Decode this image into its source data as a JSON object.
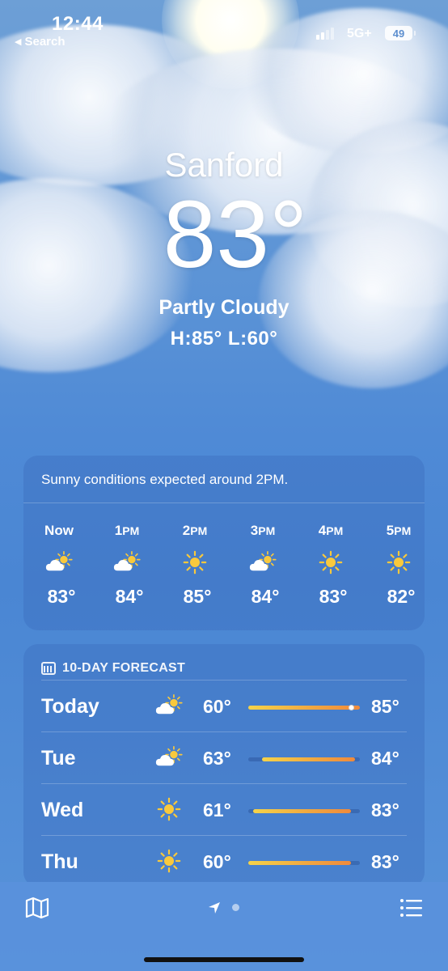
{
  "status_bar": {
    "time": "12:44",
    "back_label": "Search",
    "network": "5G+",
    "battery": "49"
  },
  "location": {
    "city": "Sanford",
    "temperature": "83°",
    "condition": "Partly Cloudy",
    "high_low": "H:85°  L:60°"
  },
  "hourly": {
    "summary": "Sunny conditions expected around 2PM.",
    "hours": [
      {
        "time": "Now",
        "icon": "partly-cloudy-icon",
        "temp": "83°"
      },
      {
        "time": "1PM",
        "icon": "partly-cloudy-icon",
        "temp": "84°"
      },
      {
        "time": "2PM",
        "icon": "sun-icon",
        "temp": "85°"
      },
      {
        "time": "3PM",
        "icon": "partly-cloudy-icon",
        "temp": "84°"
      },
      {
        "time": "4PM",
        "icon": "sun-icon",
        "temp": "83°"
      },
      {
        "time": "5PM",
        "icon": "sun-icon",
        "temp": "82°"
      }
    ]
  },
  "forecast": {
    "title": "10-DAY FORECAST",
    "range_min": 60,
    "range_max": 85,
    "days": [
      {
        "day": "Today",
        "icon": "partly-cloudy-icon",
        "low": "60°",
        "high": "85°",
        "low_val": 60,
        "high_val": 85,
        "current": 83
      },
      {
        "day": "Tue",
        "icon": "partly-cloudy-icon",
        "low": "63°",
        "high": "84°",
        "low_val": 63,
        "high_val": 84
      },
      {
        "day": "Wed",
        "icon": "sun-icon",
        "low": "61°",
        "high": "83°",
        "low_val": 61,
        "high_val": 83
      },
      {
        "day": "Thu",
        "icon": "sun-icon",
        "low": "60°",
        "high": "83°",
        "low_val": 60,
        "high_val": 83
      }
    ]
  },
  "toolbar": {
    "map_icon": "map-icon",
    "location_icon": "location-arrow-icon",
    "list_icon": "list-icon"
  },
  "colors": {
    "sky": "#5b93d6",
    "sun": "#f9c93c",
    "bar_start": "#f5d34a",
    "bar_end": "#ef8a3c"
  }
}
